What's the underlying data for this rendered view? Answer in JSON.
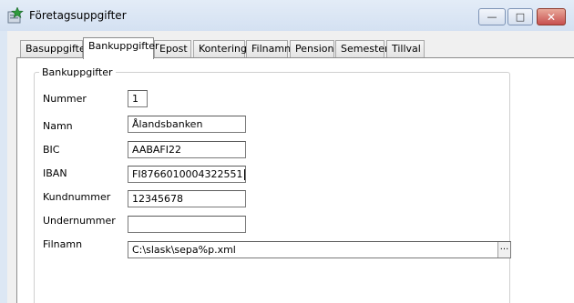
{
  "window": {
    "title": "Företagsuppgifter"
  },
  "controls": {
    "minimize": "—",
    "maximize": "□",
    "close": "✕"
  },
  "tabs": [
    {
      "label": "Basuppgifter"
    },
    {
      "label": "Bankuppgifter"
    },
    {
      "label": "Epost"
    },
    {
      "label": "Kontering"
    },
    {
      "label": "Filnamn"
    },
    {
      "label": "Pension"
    },
    {
      "label": "Semester"
    },
    {
      "label": "Tillval"
    }
  ],
  "group": {
    "title": "Bankuppgifter"
  },
  "form": {
    "nummer": {
      "label": "Nummer",
      "value": "1"
    },
    "namn": {
      "label": "Namn",
      "value": "Ålandsbanken"
    },
    "bic": {
      "label": "BIC",
      "value": "AABAFI22"
    },
    "iban": {
      "label": "IBAN",
      "value": "FI8766010004322551"
    },
    "kundnummer": {
      "label": "Kundnummer",
      "value": "12345678"
    },
    "undernummer": {
      "label": "Undernummer",
      "value": ""
    },
    "filnamn": {
      "label": "Filnamn",
      "value": "C:\\slask\\sepa%p.xml",
      "browse": "..."
    }
  },
  "icons": {
    "app": "app-star-icon"
  }
}
